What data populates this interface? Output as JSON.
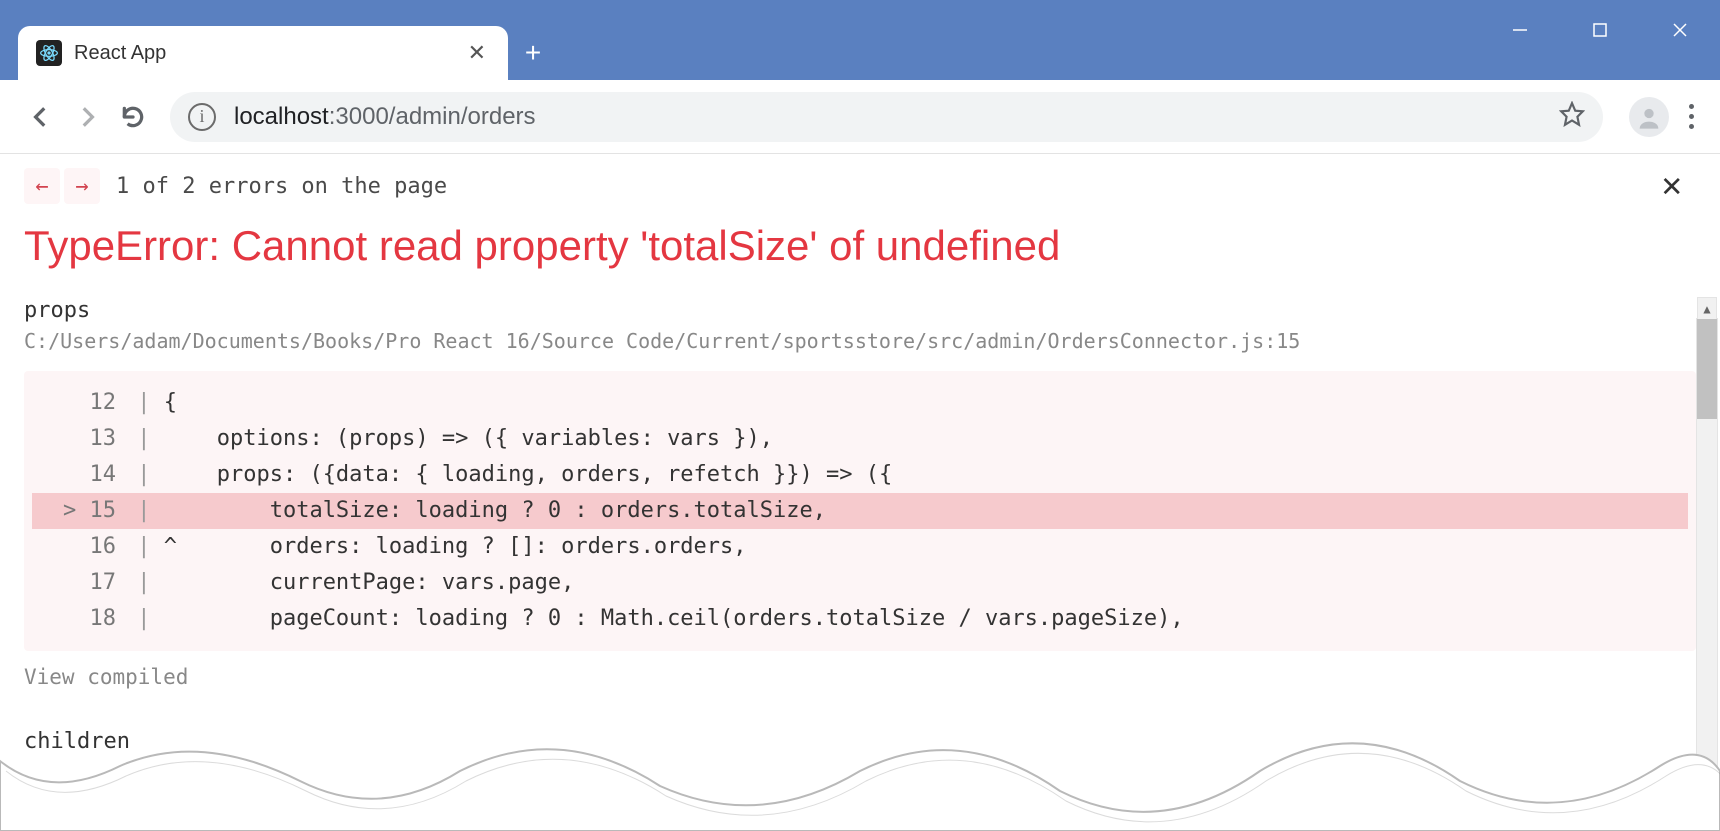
{
  "window": {
    "tabTitle": "React App"
  },
  "address": {
    "host": "localhost",
    "port": ":3000",
    "path": "/admin/orders"
  },
  "overlay": {
    "errNav": {
      "prev": "←",
      "next": "→"
    },
    "errCount": "1 of 2 errors on the page",
    "title": "TypeError: Cannot read property 'totalSize' of undefined",
    "stackLabel": "props",
    "stackFile": "C:/Users/adam/Documents/Books/Pro React 16/Source Code/Current/sportsstore/src/admin/OrdersConnector.js:15",
    "code": [
      {
        "num": "  12",
        "sep": " | ",
        "text": "{",
        "hl": false
      },
      {
        "num": "  13",
        "sep": " | ",
        "text": "    options: (props) => ({ variables: vars }),",
        "hl": false
      },
      {
        "num": "  14",
        "sep": " | ",
        "text": "    props: ({data: { loading, orders, refetch }}) => ({",
        "hl": false
      },
      {
        "num": "> 15",
        "sep": " | ",
        "text": "        totalSize: loading ? 0 : orders.totalSize,",
        "hl": true
      },
      {
        "num": "  16",
        "sep": " | ",
        "text": "^       orders: loading ? []: orders.orders,",
        "hl": false
      },
      {
        "num": "  17",
        "sep": " | ",
        "text": "        currentPage: vars.page,",
        "hl": false
      },
      {
        "num": "  18",
        "sep": " | ",
        "text": "        pageCount: loading ? 0 : Math.ceil(orders.totalSize / vars.pageSize),",
        "hl": false
      }
    ],
    "viewCompiled": "View compiled",
    "childrenLabel": "children"
  }
}
